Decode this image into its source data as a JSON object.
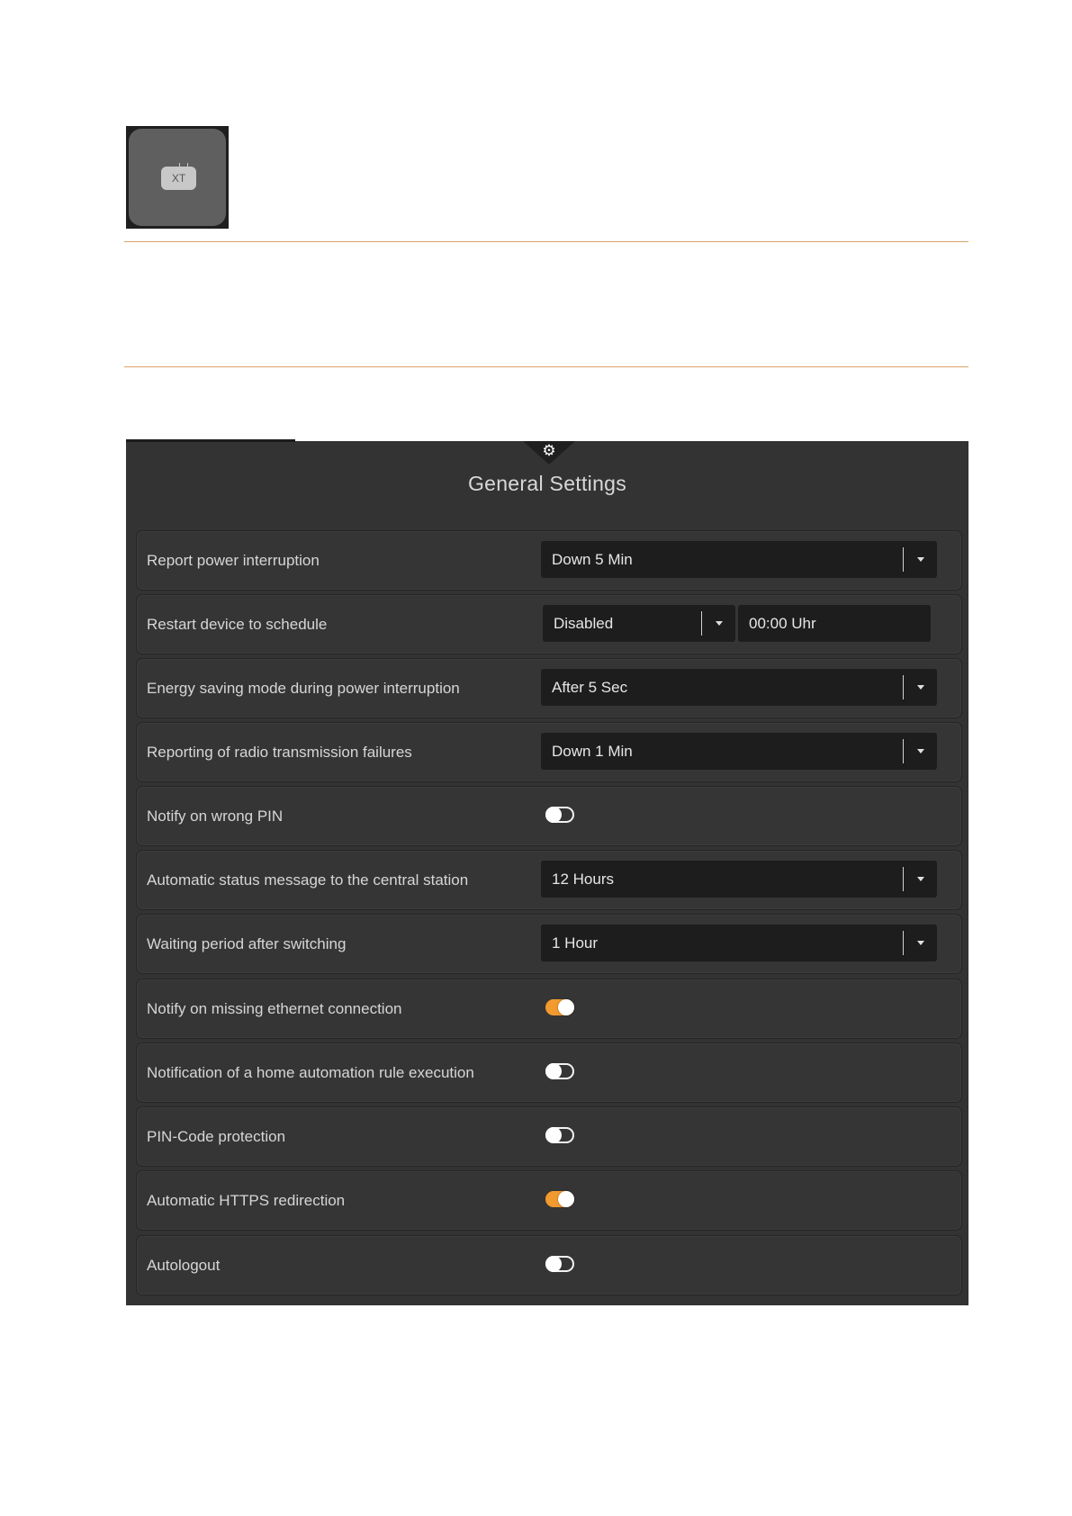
{
  "logo": {
    "text": "XT"
  },
  "panel": {
    "title": "General Settings",
    "icon": "gear-icon",
    "accent_color": "#f29a2e",
    "rows": [
      {
        "label": "Report power interruption",
        "type": "select",
        "value": "Down 5 Min"
      },
      {
        "label": "Restart device to schedule",
        "type": "select-time",
        "value": "Disabled",
        "time": "00:00 Uhr"
      },
      {
        "label": "Energy saving mode during power interruption",
        "type": "select",
        "value": "After 5 Sec"
      },
      {
        "label": "Reporting of radio transmission failures",
        "type": "select",
        "value": "Down 1 Min"
      },
      {
        "label": "Notify on wrong PIN",
        "type": "toggle",
        "checked": false
      },
      {
        "label": "Automatic status message to the central station",
        "type": "select",
        "value": "12 Hours"
      },
      {
        "label": "Waiting period after switching",
        "type": "select",
        "value": "1 Hour"
      },
      {
        "label": "Notify on missing ethernet connection",
        "type": "toggle",
        "checked": true
      },
      {
        "label": "Notification of a home automation rule execution",
        "type": "toggle",
        "checked": false
      },
      {
        "label": "PIN-Code protection",
        "type": "toggle",
        "checked": false
      },
      {
        "label": "Automatic HTTPS redirection",
        "type": "toggle",
        "checked": true
      },
      {
        "label": "Autologout",
        "type": "toggle",
        "checked": false
      }
    ]
  }
}
